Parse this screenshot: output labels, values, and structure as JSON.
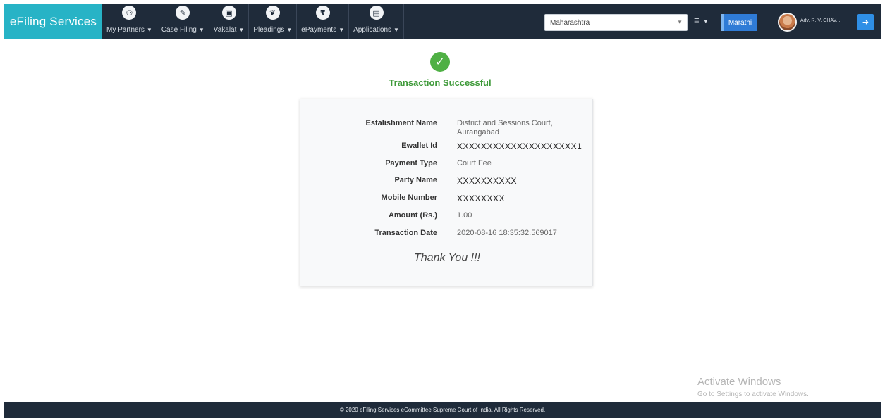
{
  "brand": "eFiling Services",
  "menu": [
    {
      "label": "My Partners",
      "icon": "users-icon",
      "glyph": "⚇"
    },
    {
      "label": "Case Filing",
      "icon": "pencil-icon",
      "glyph": "✎"
    },
    {
      "label": "Vakalat",
      "icon": "document-icon",
      "glyph": "▣"
    },
    {
      "label": "Pleadings",
      "icon": "leaf-icon",
      "glyph": "❦"
    },
    {
      "label": "ePayments",
      "icon": "rupee-icon",
      "glyph": "₹"
    },
    {
      "label": "Applications",
      "icon": "file-icon",
      "glyph": "▤"
    }
  ],
  "state_select": {
    "value": "Maharashtra"
  },
  "hamburger": "≡",
  "language_button": "Marathi",
  "user": {
    "name": "Adv. R. V. CHAV..."
  },
  "logout_glyph": "➜",
  "success": {
    "icon_glyph": "✓",
    "title": "Transaction Successful"
  },
  "details": [
    {
      "label": "Estalishment Name",
      "value": "District and Sessions Court, Aurangabad"
    },
    {
      "label": "Ewallet Id",
      "value": "XXXXXXXXXXXXXXXXXXXX1"
    },
    {
      "label": "Payment Type",
      "value": "Court Fee"
    },
    {
      "label": "Party Name",
      "value": "XXXXXXXXXX"
    },
    {
      "label": "Mobile Number",
      "value": "XXXXXXXX"
    },
    {
      "label": "Amount (Rs.)",
      "value": "1.00"
    },
    {
      "label": "Transaction Date",
      "value": "2020-08-16 18:35:32.569017"
    }
  ],
  "thank_you": "Thank You !!!",
  "watermark": {
    "title": "Activate Windows",
    "subtitle": "Go to Settings to activate Windows."
  },
  "footer": "© 2020 eFiling Services eCommittee Supreme Court of India. All Rights Reserved.",
  "colors": {
    "navbar": "#1f2b3a",
    "brand": "#27b3c6",
    "success": "#4fb044",
    "button": "#2f7bd6"
  }
}
